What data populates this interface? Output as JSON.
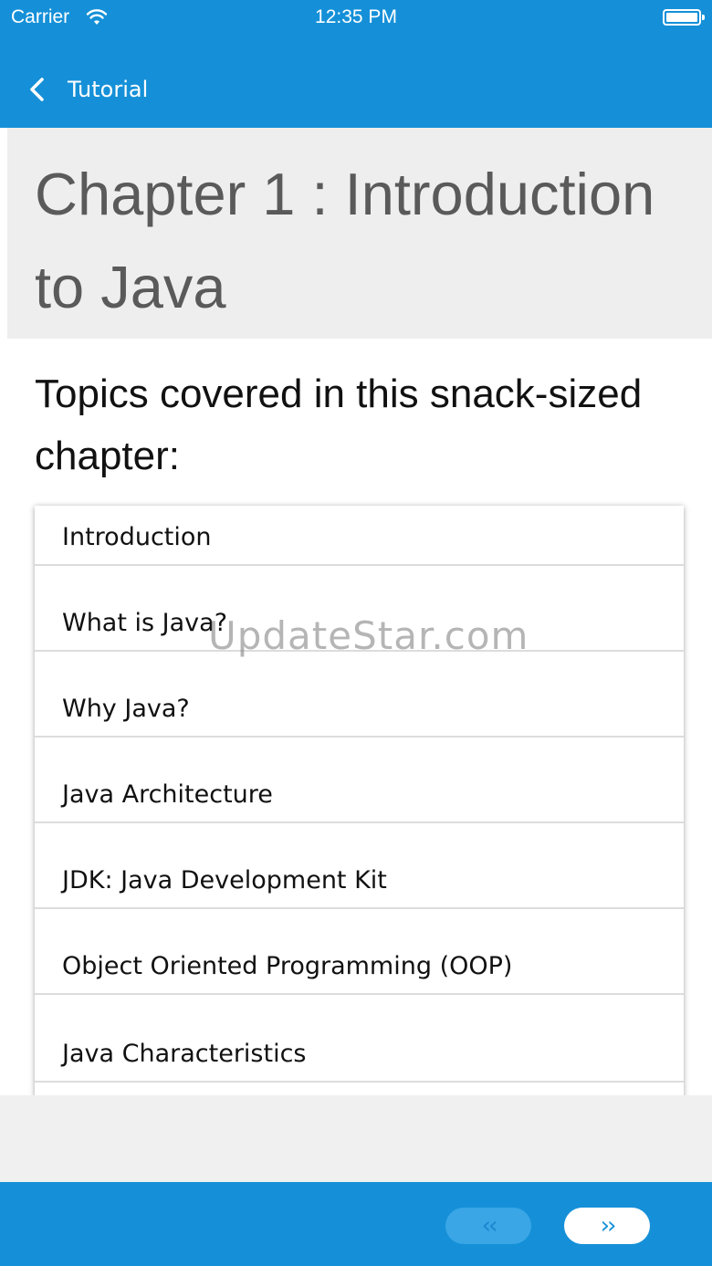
{
  "status_bar": {
    "carrier": "Carrier",
    "time": "12:35 PM"
  },
  "nav": {
    "back_label": "Tutorial"
  },
  "chapter": {
    "title": "Chapter 1 : Introduction to Java"
  },
  "topics_heading": "Topics covered in this snack-sized chapter:",
  "topics": [
    "Introduction",
    "What is Java?",
    "Why Java?",
    "Java Architecture",
    "JDK: Java Development Kit",
    "Object Oriented Programming (OOP)",
    "Java Characteristics"
  ],
  "watermark": "UpdateStar.com",
  "footer": {
    "prev_label": "‹‹",
    "next_label": "››",
    "prev_enabled": false,
    "next_enabled": true
  },
  "colors": {
    "accent": "#1590d8",
    "chapter_bg": "#eeeeee",
    "footer_bg": "#f0f0f0"
  }
}
